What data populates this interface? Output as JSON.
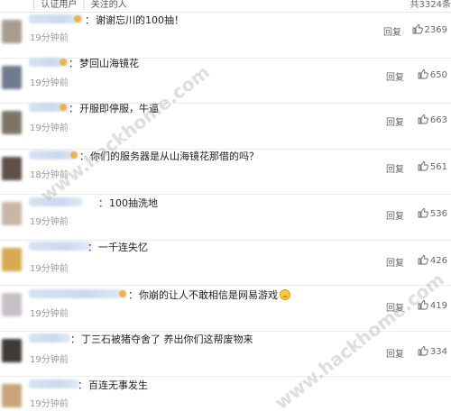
{
  "header": {
    "filters": [
      "认证用户",
      "关注的人"
    ],
    "total": "共3324条"
  },
  "comments": [
    {
      "text": "谢谢忘川的100抽！",
      "time": "19分钟前",
      "reply": "回复",
      "likes": "2369",
      "avatar_color": "#a89c8e"
    },
    {
      "text": "梦回山海镜花",
      "time": "19分钟前",
      "reply": "回复",
      "likes": "650",
      "avatar_color": "#6f7b8e"
    },
    {
      "text": "开服即停服，牛逼",
      "time": "19分钟前",
      "reply": "回复",
      "likes": "663",
      "avatar_color": "#7d7467"
    },
    {
      "text": "你们的服务器是从山海镜花那借的吗？",
      "time": "18分钟前",
      "reply": "回复",
      "likes": "561",
      "avatar_color": "#5e4f48"
    },
    {
      "text": "100抽洗地",
      "time": "19分钟前",
      "reply": "回复",
      "likes": "536",
      "avatar_color": "#c9b7a6"
    },
    {
      "text": "一千连失忆",
      "time": "19分钟前",
      "reply": "回复",
      "likes": "426",
      "avatar_color": "#d5a94f"
    },
    {
      "text": "你崩的让人不敢相信是网易游戏",
      "time": "19分钟前",
      "reply": "回复",
      "likes": "419",
      "avatar_color": "#c8c0c8"
    },
    {
      "text": "丁三石被猪夺舍了 养出你们这帮废物来",
      "time": "19分钟前",
      "reply": "回复",
      "likes": "334",
      "avatar_color": "#3f3a35"
    },
    {
      "text": "百连无事发生",
      "time": "19分钟前",
      "reply": "回复",
      "likes": "",
      "avatar_color": "#c9a47a"
    }
  ],
  "watermark": "www.hackhome.com",
  "icons": {
    "like": "thumbs-up-icon",
    "emoji": "sweat-smile-emoji-icon"
  }
}
